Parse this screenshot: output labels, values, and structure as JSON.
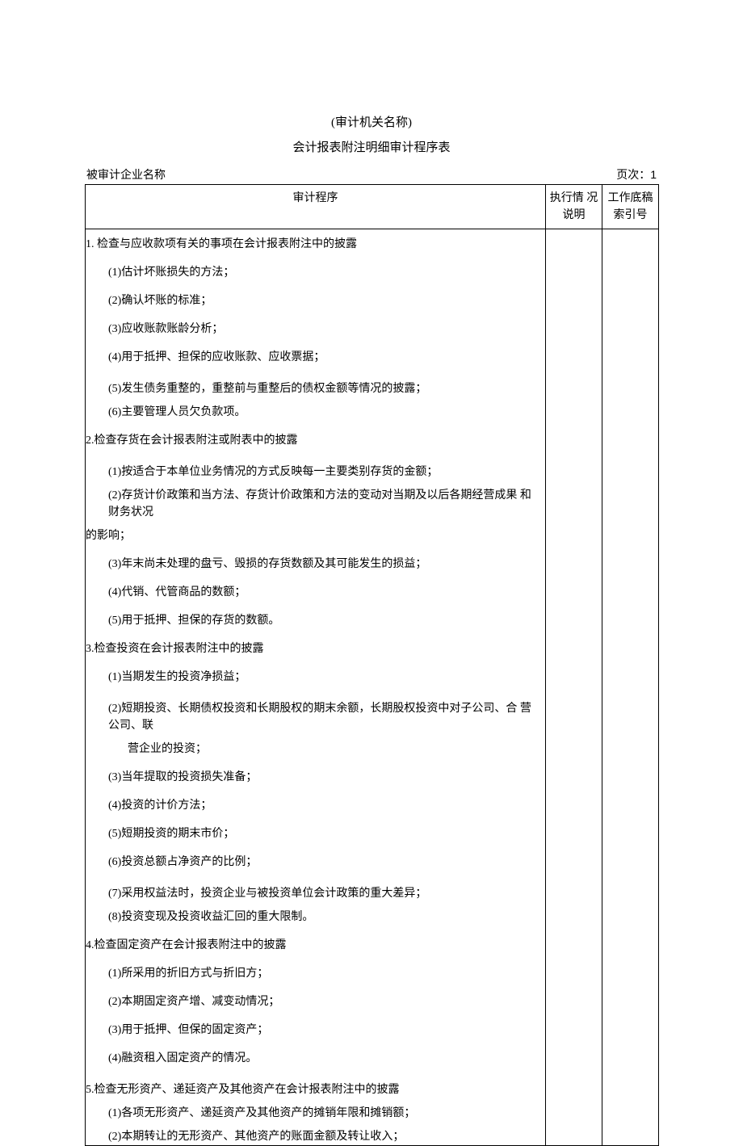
{
  "header": {
    "org_placeholder": "(审计机关名称)",
    "doc_title": "会计报表附注明细审计程序表"
  },
  "meta": {
    "company_label": "被审计企业名称",
    "page_label": "页次：",
    "page_number": "1"
  },
  "table": {
    "th_proc": "审计程序",
    "th_exec": "执行情 况说明",
    "th_ref": "工作底稿 索引号"
  },
  "rows": {
    "s1": "1. 检查与应收款项有关的事项在会计报表附注中的披露",
    "s1_1": "(1)估计坏账损失的方法；",
    "s1_2": "(2)确认坏账的标准；",
    "s1_3": "(3)应收账款账龄分析；",
    "s1_4": "(4)用于抵押、担保的应收账款、应收票据；",
    "s1_5": "(5)发生债务重整的，重整前与重整后的债权金额等情况的披露；",
    "s1_6": "(6)主要管理人员欠负款项。",
    "s2": "2.检查存货在会计报表附注或附表中的披露",
    "s2_1": "(1)按适合于本单位业务情况的方式反映每一主要类别存货的金额；",
    "s2_2a": "(2)存货计价政策和当方法、存货计价政策和方法的变动对当期及以后各期经营成果 和财务状况",
    "s2_2b": "的影响；",
    "s2_3": "(3)年末尚未处理的盘亏、毁损的存货数额及其可能发生的损益；",
    "s2_4": "(4)代销、代管商品的数额；",
    "s2_5": "(5)用于抵押、担保的存货的数额。",
    "s3": "3.检查投资在会计报表附注中的披露",
    "s3_1": "(1)当期发生的投资净损益；",
    "s3_2a": "(2)短期投资、长期债权投资和长期股权的期末余额，长期股权投资中对子公司、合 营公司、联",
    "s3_2b": "营企业的投资；",
    "s3_3": "(3)当年提取的投资损失准备；",
    "s3_4": "(4)投资的计价方法；",
    "s3_5": "(5)短期投资的期末市价；",
    "s3_6": "(6)投资总额占净资产的比例；",
    "s3_7": "(7)采用权益法时，投资企业与被投资单位会计政策的重大差异；",
    "s3_8": "(8)投资变现及投资收益汇回的重大限制。",
    "s4": "4.检查固定资产在会计报表附注中的披露",
    "s4_1": "(1)所采用的折旧方式与折旧方；",
    "s4_2": "(2)本期固定资产增、减变动情况；",
    "s4_3": "(3)用于抵押、但保的固定资产；",
    "s4_4": "(4)融资租入固定资产的情况。",
    "s5": "5.检查无形资产、递延资产及其他资产在会计报表附注中的披露",
    "s5_1": "(1)各项无形资产、递延资产及其他资产的摊销年限和摊销额；",
    "s5_2": "(2)本期转让的无形资产、其他资产的账面金额及转让收入；"
  }
}
